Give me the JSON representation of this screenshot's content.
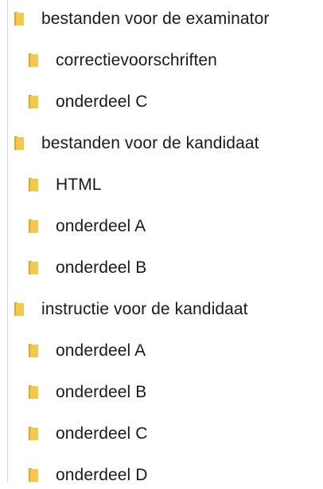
{
  "folder_tree": {
    "items": [
      {
        "label": "bestanden voor de examinator",
        "level": 0,
        "icon": "folder-icon"
      },
      {
        "label": "correctievoorschriften",
        "level": 1,
        "icon": "folder-icon"
      },
      {
        "label": "onderdeel C",
        "level": 1,
        "icon": "folder-icon"
      },
      {
        "label": "bestanden voor de kandidaat",
        "level": 0,
        "icon": "folder-icon"
      },
      {
        "label": "HTML",
        "level": 1,
        "icon": "folder-icon"
      },
      {
        "label": "onderdeel A",
        "level": 1,
        "icon": "folder-icon"
      },
      {
        "label": "onderdeel B",
        "level": 1,
        "icon": "folder-icon"
      },
      {
        "label": "instructie voor de kandidaat",
        "level": 0,
        "icon": "folder-icon"
      },
      {
        "label": "onderdeel A",
        "level": 1,
        "icon": "folder-icon"
      },
      {
        "label": "onderdeel B",
        "level": 1,
        "icon": "folder-icon"
      },
      {
        "label": "onderdeel C",
        "level": 1,
        "icon": "folder-icon"
      },
      {
        "label": "onderdeel D",
        "level": 1,
        "icon": "folder-icon"
      }
    ]
  },
  "colors": {
    "folder_front": "#f2c94c",
    "folder_back": "#dca92e",
    "text": "#1a1a1a"
  }
}
